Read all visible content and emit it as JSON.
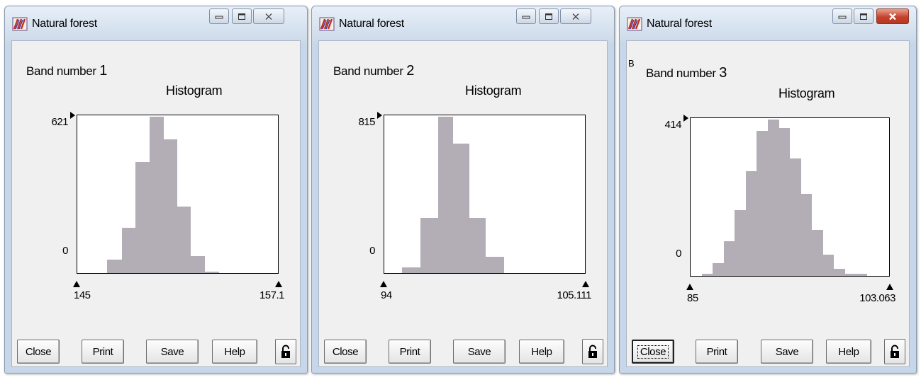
{
  "windows": [
    {
      "title": "Natural forest",
      "band_label": "Band number",
      "band_number": "1",
      "corner_mark": "",
      "histogram_title": "Histogram",
      "y_max_label": "621",
      "y_zero_label": "0",
      "x_min_label": "145",
      "x_max_label": "157.1",
      "close_style": "plain",
      "buttons": {
        "close": "Close",
        "print": "Print",
        "save": "Save",
        "help": "Help"
      }
    },
    {
      "title": "Natural forest",
      "band_label": "Band number",
      "band_number": "2",
      "corner_mark": "",
      "histogram_title": "Histogram",
      "y_max_label": "815",
      "y_zero_label": "0",
      "x_min_label": "94",
      "x_max_label": "105.111",
      "close_style": "plain",
      "buttons": {
        "close": "Close",
        "print": "Print",
        "save": "Save",
        "help": "Help"
      }
    },
    {
      "title": "Natural forest",
      "band_label": "Band number",
      "band_number": "3",
      "corner_mark": "B",
      "histogram_title": "Histogram",
      "y_max_label": "414",
      "y_zero_label": "0",
      "x_min_label": "85",
      "x_max_label": "103.063",
      "close_style": "red",
      "buttons": {
        "close": "Close",
        "print": "Print",
        "save": "Save",
        "help": "Help"
      }
    }
  ],
  "colors": {
    "histogram_bar": "#b3aeb5",
    "window_frame": "#c7d6e8",
    "client_background": "#f0f0f0",
    "plot_background": "#ffffff"
  },
  "icons": {
    "app": "natural-forest-app-icon",
    "minimize": "minimize-icon",
    "maximize": "maximize-icon",
    "close": "close-x-icon",
    "lock": "padlock-icon"
  },
  "histograms": [
    {
      "band": "1",
      "x_range": [
        145,
        157.1
      ],
      "y_range": [
        0,
        621
      ],
      "bins": [
        {
          "from": 146.8,
          "to": 147.68,
          "count": 53
        },
        {
          "from": 147.68,
          "to": 148.51,
          "count": 179
        },
        {
          "from": 148.51,
          "to": 149.34,
          "count": 442
        },
        {
          "from": 149.34,
          "to": 150.17,
          "count": 621
        },
        {
          "from": 150.17,
          "to": 151.0,
          "count": 531
        },
        {
          "from": 151.0,
          "to": 151.83,
          "count": 265
        },
        {
          "from": 151.83,
          "to": 152.66,
          "count": 67
        },
        {
          "from": 152.66,
          "to": 153.53,
          "count": 6
        }
      ]
    },
    {
      "band": "2",
      "x_range": [
        94,
        105.111
      ],
      "y_range": [
        0,
        815
      ],
      "bins": [
        {
          "from": 95.0,
          "to": 96.0,
          "count": 29
        },
        {
          "from": 96.0,
          "to": 97.0,
          "count": 288
        },
        {
          "from": 97.0,
          "to": 97.8,
          "count": 815
        },
        {
          "from": 97.8,
          "to": 98.7,
          "count": 676
        },
        {
          "from": 98.7,
          "to": 99.6,
          "count": 288
        },
        {
          "from": 99.6,
          "to": 100.6,
          "count": 86
        }
      ]
    },
    {
      "band": "3",
      "x_range": [
        85,
        103.063
      ],
      "y_range": [
        0,
        414
      ],
      "bins": [
        {
          "from": 86.0,
          "to": 87.0,
          "count": 6
        },
        {
          "from": 87.0,
          "to": 88.0,
          "count": 33
        },
        {
          "from": 88.0,
          "to": 89.0,
          "count": 91
        },
        {
          "from": 89.0,
          "to": 90.0,
          "count": 175
        },
        {
          "from": 90.0,
          "to": 91.0,
          "count": 278
        },
        {
          "from": 91.0,
          "to": 92.0,
          "count": 384
        },
        {
          "from": 92.0,
          "to": 93.0,
          "count": 414
        },
        {
          "from": 93.0,
          "to": 94.0,
          "count": 391
        },
        {
          "from": 94.0,
          "to": 95.0,
          "count": 311
        },
        {
          "from": 95.0,
          "to": 96.0,
          "count": 217
        },
        {
          "from": 96.0,
          "to": 97.0,
          "count": 122
        },
        {
          "from": 97.0,
          "to": 98.0,
          "count": 57
        },
        {
          "from": 98.0,
          "to": 99.0,
          "count": 18
        },
        {
          "from": 99.0,
          "to": 100.0,
          "count": 6
        },
        {
          "from": 100.0,
          "to": 101.0,
          "count": 6
        }
      ]
    }
  ]
}
